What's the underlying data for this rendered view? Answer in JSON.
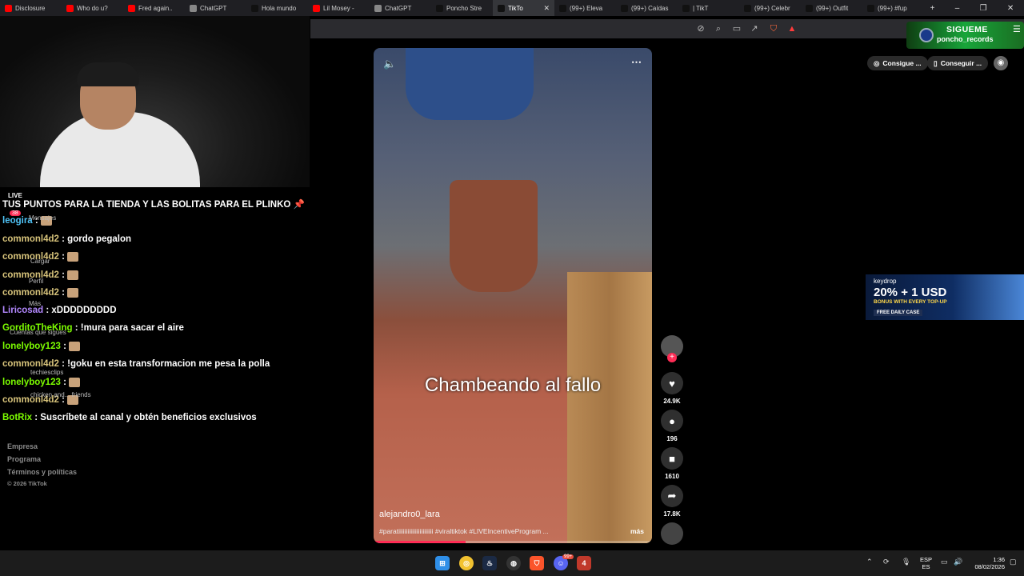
{
  "browser": {
    "tabs": [
      {
        "title": "Disclosure",
        "color": "#ff0000"
      },
      {
        "title": "Who do u?",
        "color": "#ff0000"
      },
      {
        "title": "Fred again..",
        "color": "#ff0000"
      },
      {
        "title": "ChatGPT",
        "color": "#888888"
      },
      {
        "title": "Hola mundo",
        "color": "#111111"
      },
      {
        "title": "Lil Mosey -",
        "color": "#ff0000"
      },
      {
        "title": "ChatGPT",
        "color": "#888888"
      },
      {
        "title": "Poncho Stre",
        "color": "#111111"
      },
      {
        "title": "TikTo",
        "color": "#111111",
        "active": true
      },
      {
        "title": "(99+) Eleva",
        "color": "#111111"
      },
      {
        "title": "(99+) Caídas",
        "color": "#111111"
      },
      {
        "title": "| TikT",
        "color": "#111111"
      },
      {
        "title": "(99+) Celebr",
        "color": "#111111"
      },
      {
        "title": "(99+) Outfit",
        "color": "#111111"
      },
      {
        "title": "(99+) #fup",
        "color": "#111111"
      }
    ],
    "new_tab": "+",
    "window_controls": {
      "minimize": "–",
      "restore": "❐",
      "close": "✕"
    }
  },
  "overlay": {
    "follow_title": "SIGUEME",
    "follow_handle": "poncho_records",
    "chat_header_line": "TUS PUNTOS PARA LA TIENDA Y LAS BOLITAS PARA EL PLINKO",
    "live_label": "LIVE"
  },
  "chat": [
    {
      "user": "leogira",
      "text": "",
      "color": "#4fc3f7",
      "emote": true
    },
    {
      "user": "commonl4d2",
      "text": "gordo pegalon",
      "color": "#d6c27a",
      "emote": false
    },
    {
      "user": "commonl4d2",
      "text": "",
      "color": "#d6c27a",
      "emote": true
    },
    {
      "user": "commonl4d2",
      "text": "",
      "color": "#d6c27a",
      "emote": true
    },
    {
      "user": "commonl4d2",
      "text": "",
      "color": "#d6c27a",
      "emote": true
    },
    {
      "user": "Liricosad",
      "text": "xDDDDDDDDD",
      "color": "#b388ff",
      "emote": false
    },
    {
      "user": "GorditoTheKing",
      "text": "!mura para sacar el aire",
      "color": "#7cfc00",
      "emote": false
    },
    {
      "user": "lonelyboy123",
      "text": "",
      "color": "#7cfc00",
      "emote": true
    },
    {
      "user": "commonl4d2",
      "text": "!goku en esta transformacion me pesa la polla",
      "color": "#d6c27a",
      "emote": false
    },
    {
      "user": "lonelyboy123",
      "text": "",
      "color": "#7cfc00",
      "emote": true
    },
    {
      "user": "commonl4d2",
      "text": "",
      "color": "#d6c27a",
      "emote": true
    },
    {
      "user": "BotRix",
      "text": "Suscríbete al canal y obtén beneficios exclusivos",
      "color": "#7cfc00",
      "emote": false
    }
  ],
  "tiktok_sidebar": {
    "items": [
      "Mensajes",
      "Cargar",
      "Perfil",
      "Más",
      "Cuentas que sigues",
      "techiesclips",
      "chicken and... friends"
    ],
    "badge": "38",
    "footer": [
      "Empresa",
      "Programa",
      "Términos y políticas",
      "© 2026 TikTok"
    ]
  },
  "video": {
    "caption": "Chambeando al fallo",
    "username": "alejandro0_lara",
    "description": "#paratiiiiiiiiiiiiiiiiiiiiiii #viraltiktok #LIVEIncentiveProgram ...",
    "more": "más",
    "progress": 0.33
  },
  "actions": {
    "likes": "24.9K",
    "comments": "196",
    "saves": "1610",
    "shares": "17.8K"
  },
  "right_buttons": {
    "btn1": "Consigue ...",
    "btn2": "Conseguir ..."
  },
  "ad": {
    "brand": "keydrop",
    "headline": "20% + 1 USD",
    "sub": "BONUS WITH EVERY TOP-UP",
    "cta": "FREE DAILY CASE"
  },
  "taskbar": {
    "lang_top": "ESP",
    "lang_bottom": "ES",
    "time": "1:36",
    "date": "08/02/2026",
    "discord_badge": "99+"
  }
}
